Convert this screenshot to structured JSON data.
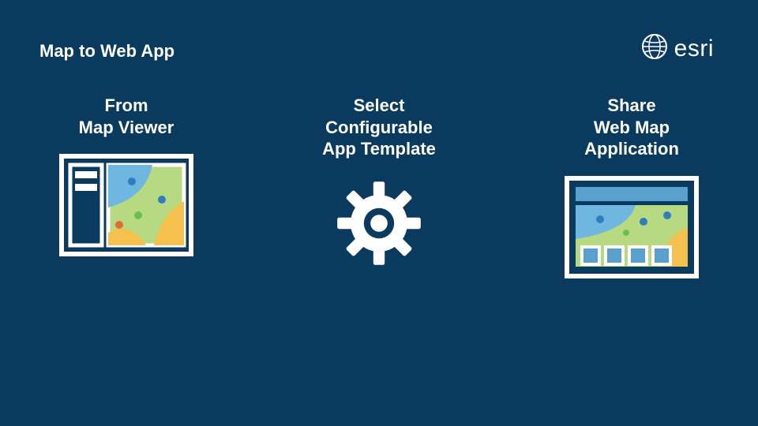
{
  "title": "Map to Web App",
  "brand": "esri",
  "columns": [
    {
      "title": "From\nMap Viewer"
    },
    {
      "title": "Select\nConfigurable\nApp Template"
    },
    {
      "title": "Share\nWeb Map\nApplication"
    }
  ]
}
